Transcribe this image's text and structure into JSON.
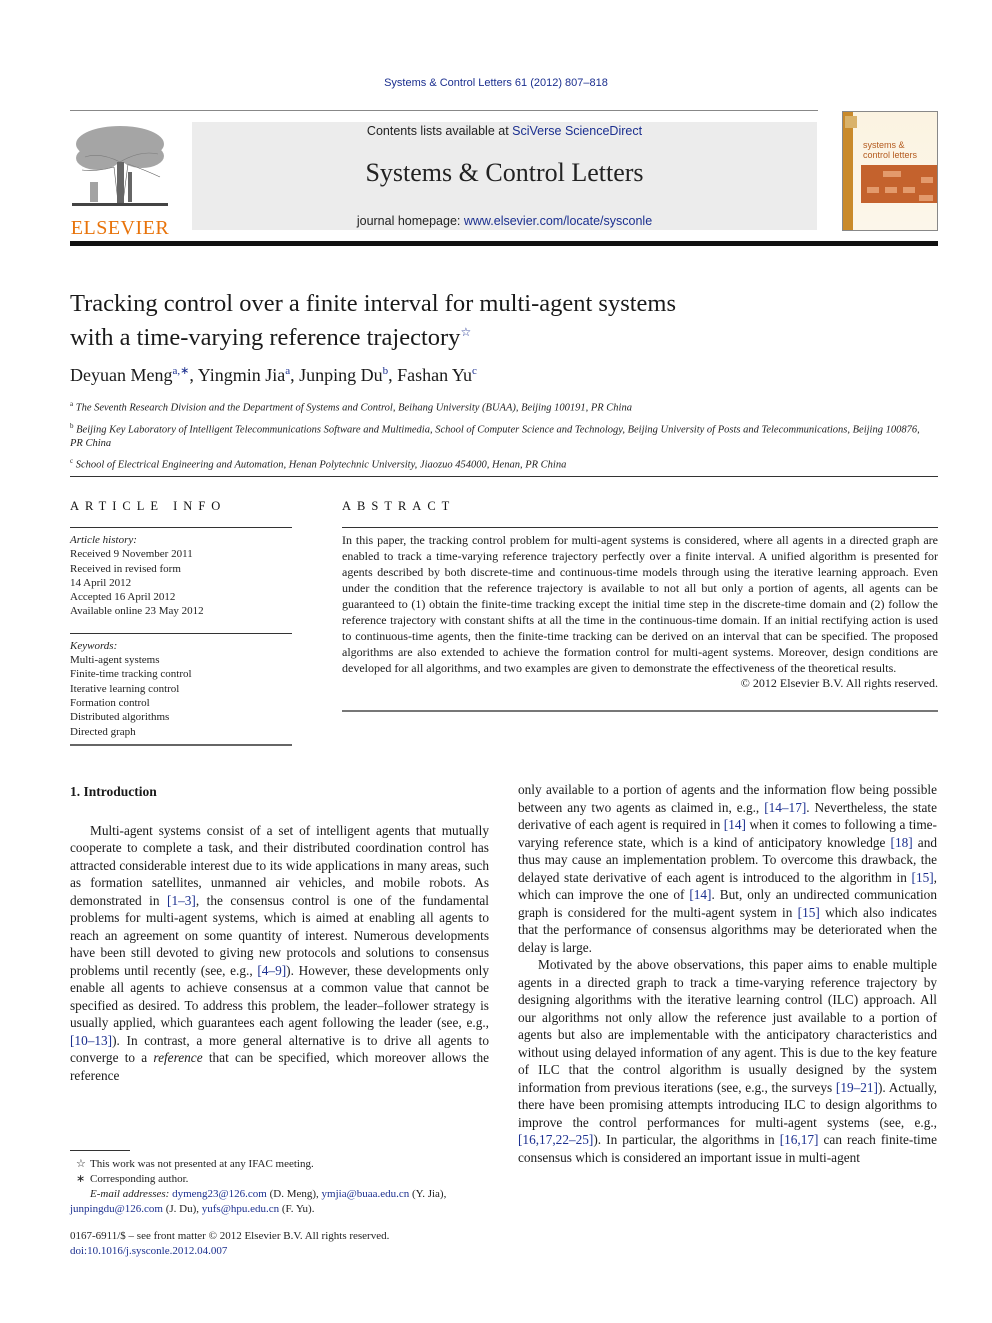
{
  "header": {
    "journal_ref": "Systems & Control Letters 61 (2012) 807–818",
    "contents_prefix": "Contents lists available at ",
    "contents_link": "SciVerse ScienceDirect",
    "journal_title": "Systems & Control Letters",
    "homepage_prefix": "journal homepage: ",
    "homepage_link": "www.elsevier.com/locate/sysconle",
    "publisher_logo_text": "ELSEVIER",
    "cover_title_line1": "systems &",
    "cover_title_line2": "control letters"
  },
  "colors": {
    "link": "#1b2f8f",
    "elsevier_orange": "#e8730a",
    "masthead_bg": "#ececec",
    "cover_accent": "#c4622d"
  },
  "article": {
    "title_line1": "Tracking control over a finite interval for multi-agent systems",
    "title_line2": "with a time-varying reference trajectory",
    "title_note_mark": "☆",
    "authors": [
      {
        "name": "Deyuan Meng",
        "sup": "a,∗"
      },
      {
        "name": "Yingmin Jia",
        "sup": "a"
      },
      {
        "name": "Junping Du",
        "sup": "b"
      },
      {
        "name": "Fashan Yu",
        "sup": "c"
      }
    ],
    "affiliations": [
      {
        "mark": "a",
        "text": "The Seventh Research Division and the Department of Systems and Control, Beihang University (BUAA), Beijing 100191, PR China"
      },
      {
        "mark": "b",
        "text": "Beijing Key Laboratory of Intelligent Telecommunications Software and Multimedia, School of Computer Science and Technology, Beijing University of Posts and Telecommunications, Beijing 100876, PR China"
      },
      {
        "mark": "c",
        "text": "School of Electrical Engineering and Automation, Henan Polytechnic University, Jiaozuo 454000, Henan, PR China"
      }
    ]
  },
  "article_info": {
    "heading": "ARTICLE INFO",
    "history_label": "Article history:",
    "history": [
      "Received 9 November 2011",
      "Received in revised form",
      "14 April 2012",
      "Accepted 16 April 2012",
      "Available online 23 May 2012"
    ],
    "keywords_label": "Keywords:",
    "keywords": [
      "Multi-agent systems",
      "Finite-time tracking control",
      "Iterative learning control",
      "Formation control",
      "Distributed algorithms",
      "Directed graph"
    ]
  },
  "abstract": {
    "heading": "ABSTRACT",
    "text": "In this paper, the tracking control problem for multi-agent systems is considered, where all agents in a directed graph are enabled to track a time-varying reference trajectory perfectly over a finite interval. A unified algorithm is presented for agents described by both discrete-time and continuous-time models through using the iterative learning approach. Even under the condition that the reference trajectory is available to not all but only a portion of agents, all agents can be guaranteed to (1) obtain the finite-time tracking except the initial time step in the discrete-time domain and (2) follow the reference trajectory with constant shifts at all the time in the continuous-time domain. If an initial rectifying action is used to continuous-time agents, then the finite-time tracking can be derived on an interval that can be specified. The proposed algorithms are also extended to achieve the formation control for multi-agent systems. Moreover, design conditions are developed for all algorithms, and two examples are given to demonstrate the effectiveness of the theoretical results.",
    "copyright": "© 2012 Elsevier B.V. All rights reserved."
  },
  "body": {
    "section_heading": "1.  Introduction",
    "left_p1": [
      {
        "t": "Multi-agent systems consist of a set of intelligent agents that mutually cooperate to complete a task, and their distributed coordination control has attracted considerable interest due to its wide applications in many areas, such as formation satellites, unmanned air vehicles, and mobile robots. As demonstrated in "
      },
      {
        "t": "[1–3]",
        "ref": true
      },
      {
        "t": ", the consensus control is one of the fundamental problems for multi-agent systems, which is aimed at enabling all agents to reach an agreement on some quantity of interest. Numerous developments have been still devoted to giving new protocols and solutions to consensus problems until recently (see, e.g., "
      },
      {
        "t": "[4–9]",
        "ref": true
      },
      {
        "t": "). However, these developments only enable all agents to achieve consensus at a common value that cannot be specified as desired. To address this problem, the leader–follower strategy is usually applied, which guarantees each agent following the leader (see, e.g., "
      },
      {
        "t": "[10–13]",
        "ref": true
      },
      {
        "t": "). In contrast, a more general alternative is to drive all agents to converge to a "
      },
      {
        "t": "reference",
        "em": true
      },
      {
        "t": " that can be specified, which moreover allows the reference"
      }
    ],
    "right_p1": [
      {
        "t": "only available to a portion of agents and the information flow being possible between any two agents as claimed in, e.g., "
      },
      {
        "t": "[14–17]",
        "ref": true
      },
      {
        "t": ". Nevertheless, the state derivative of each agent is required in "
      },
      {
        "t": "[14]",
        "ref": true
      },
      {
        "t": " when it comes to following a time-varying reference state, which is a kind of anticipatory knowledge "
      },
      {
        "t": "[18]",
        "ref": true
      },
      {
        "t": " and thus may cause an implementation problem. To overcome this drawback, the delayed state derivative of each agent is introduced to the algorithm in "
      },
      {
        "t": "[15]",
        "ref": true
      },
      {
        "t": ", which can improve the one of "
      },
      {
        "t": "[14]",
        "ref": true
      },
      {
        "t": ". But, only an undirected communication graph is considered for the multi-agent system in "
      },
      {
        "t": "[15]",
        "ref": true
      },
      {
        "t": " which also indicates that the performance of consensus algorithms may be deteriorated when the delay is large."
      }
    ],
    "right_p2": [
      {
        "t": "Motivated by the above observations, this paper aims to enable multiple agents in a directed graph to track a time-varying reference trajectory by designing algorithms with the iterative learning control (ILC) approach. All our algorithms not only allow the reference just available to a portion of agents but also are implementable with the anticipatory characteristics and without using delayed information of any agent. This is due to the key feature of ILC that the control algorithm is usually designed by the system information from previous iterations (see, e.g., the surveys "
      },
      {
        "t": "[19–21]",
        "ref": true
      },
      {
        "t": "). Actually, there have been promising attempts introducing ILC to design algorithms to improve the control performances for multi-agent systems (see, e.g., "
      },
      {
        "t": "[16,17,22–25]",
        "ref": true
      },
      {
        "t": "). In particular, the algorithms in "
      },
      {
        "t": "[16,17]",
        "ref": true
      },
      {
        "t": " can reach finite-time consensus which is considered an important issue in multi-agent"
      }
    ]
  },
  "footnotes": {
    "star_mark": "☆",
    "star_text": "This work was not presented at any IFAC meeting.",
    "corr_mark": "∗",
    "corr_text": "Corresponding author.",
    "email_label": "E-mail addresses:",
    "emails": [
      {
        "addr": "dymeng23@126.com",
        "who": " (D. Meng), "
      },
      {
        "addr": "ymjia@buaa.edu.cn",
        "who": " (Y. Jia), "
      },
      {
        "addr": "junpingdu@126.com",
        "who": " (J. Du), "
      },
      {
        "addr": "yufs@hpu.edu.cn",
        "who": " (F. Yu)."
      }
    ],
    "front_matter": "0167-6911/$ – see front matter © 2012 Elsevier B.V. All rights reserved.",
    "doi": "doi:10.1016/j.sysconle.2012.04.007"
  }
}
